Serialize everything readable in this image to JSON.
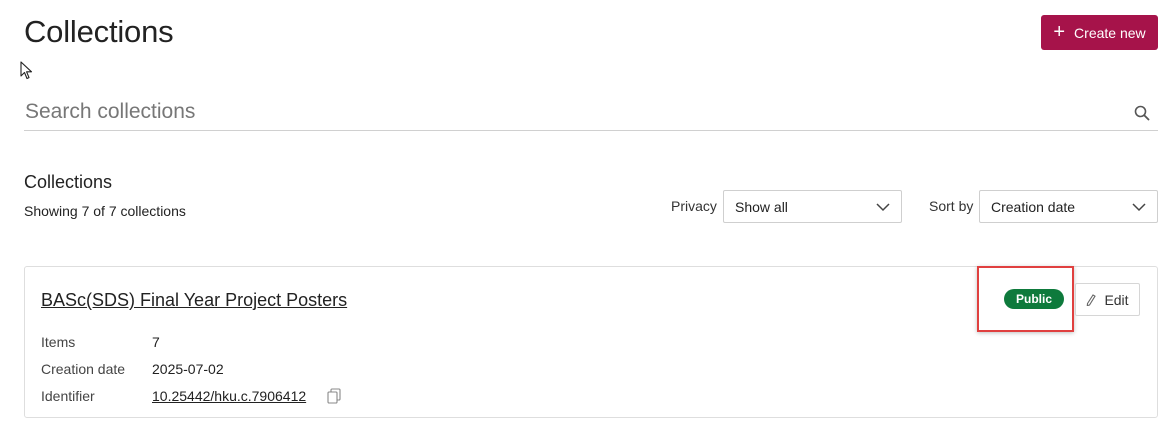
{
  "header": {
    "title": "Collections",
    "create_label": "Create new",
    "create_icon": "plus-icon",
    "accent_color": "#a6134a"
  },
  "search": {
    "placeholder": "Search collections",
    "value": "",
    "icon": "search-icon"
  },
  "list": {
    "heading": "Collections",
    "count_text": "Showing 7 of 7 collections"
  },
  "filters": {
    "privacy_label": "Privacy",
    "privacy_value": "Show all",
    "sort_label": "Sort by",
    "sort_value": "Creation date"
  },
  "collections": [
    {
      "title": "BASc(SDS) Final Year Project Posters",
      "status": "Public",
      "status_color": "#0e7a3c",
      "edit_label": "Edit",
      "items_label": "Items",
      "items_value": "7",
      "date_label": "Creation date",
      "date_value": "2025-07-02",
      "identifier_label": "Identifier",
      "identifier_value": "10.25442/hku.c.7906412"
    }
  ]
}
